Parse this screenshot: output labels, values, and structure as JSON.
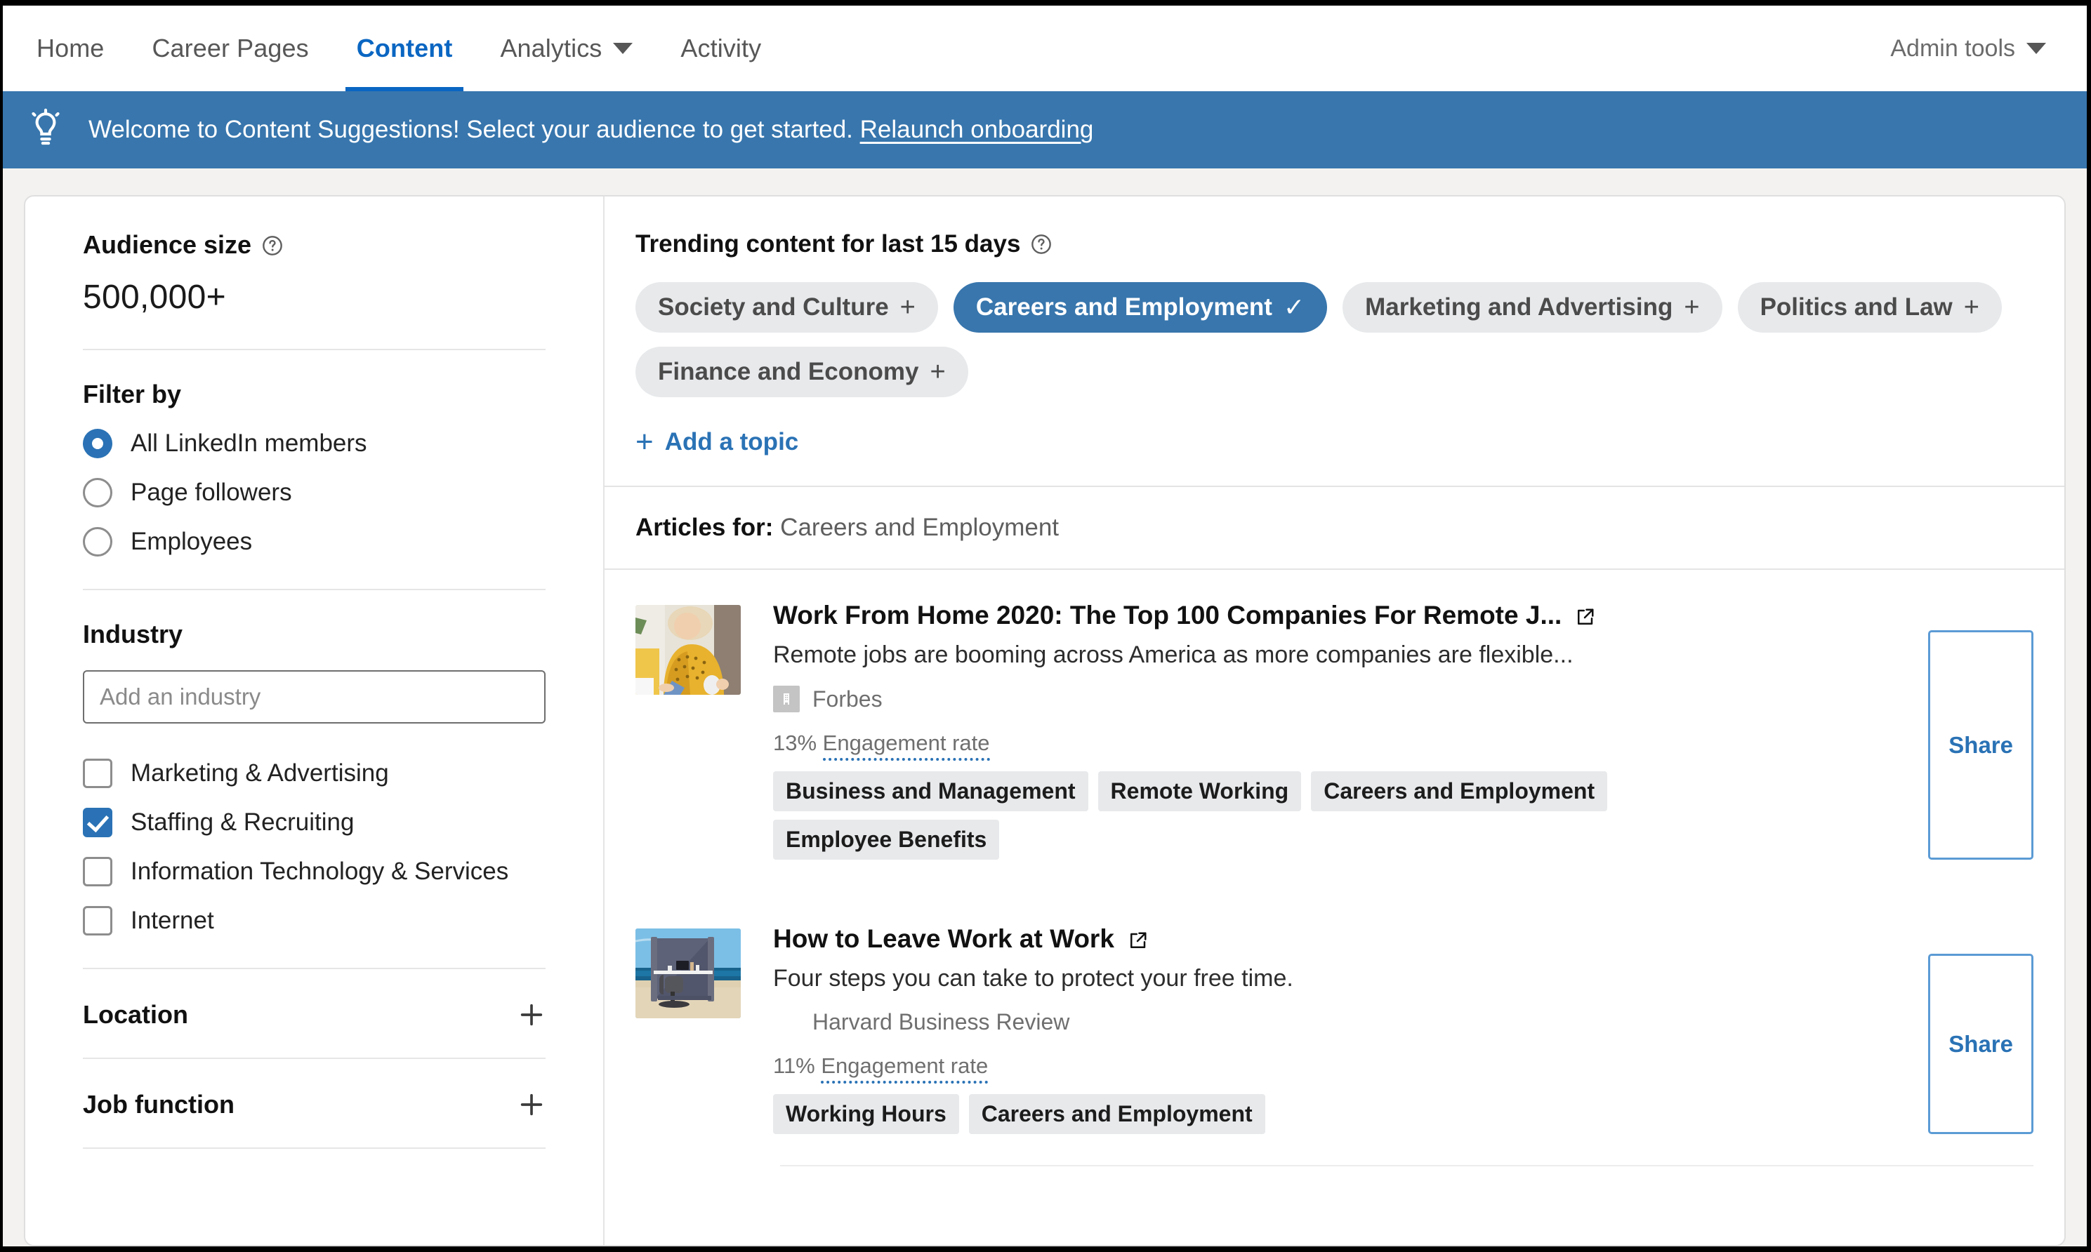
{
  "nav": {
    "items": [
      {
        "label": "Home",
        "active": false,
        "caret": false
      },
      {
        "label": "Career Pages",
        "active": false,
        "caret": false
      },
      {
        "label": "Content",
        "active": true,
        "caret": false
      },
      {
        "label": "Analytics",
        "active": false,
        "caret": true
      },
      {
        "label": "Activity",
        "active": false,
        "caret": false
      }
    ],
    "admin_tools": "Admin tools"
  },
  "banner": {
    "icon": "lightbulb-icon",
    "text": "Welcome to Content Suggestions! Select your audience to get started.",
    "link": "Relaunch onboarding",
    "background": "#3876ad"
  },
  "sidebar": {
    "audience_size_label": "Audience size",
    "audience_size_value": "500,000+",
    "filter_by_label": "Filter by",
    "audience_options": [
      {
        "label": "All LinkedIn members",
        "selected": true
      },
      {
        "label": "Page followers",
        "selected": false
      },
      {
        "label": "Employees",
        "selected": false
      }
    ],
    "industry_label": "Industry",
    "industry_placeholder": "Add an industry",
    "industry_value": "",
    "industries": [
      {
        "label": "Marketing & Advertising",
        "checked": false
      },
      {
        "label": "Staffing & Recruiting",
        "checked": true
      },
      {
        "label": "Information Technology & Services",
        "checked": false
      },
      {
        "label": "Internet",
        "checked": false
      }
    ],
    "collapsed_sections": [
      {
        "label": "Location",
        "glyph": "+"
      },
      {
        "label": "Job function",
        "glyph": "+"
      }
    ]
  },
  "main": {
    "trending_title": "Trending content for last 15 days",
    "topics": [
      {
        "label": "Society and Culture",
        "glyph": "+",
        "selected": false
      },
      {
        "label": "Careers and Employment",
        "glyph": "✓",
        "selected": true
      },
      {
        "label": "Marketing and Advertising",
        "glyph": "+",
        "selected": false
      },
      {
        "label": "Politics and Law",
        "glyph": "+",
        "selected": false
      },
      {
        "label": "Finance and Economy",
        "glyph": "+",
        "selected": false
      }
    ],
    "add_topic_label": "Add a topic",
    "articles_for_label": "Articles for:",
    "articles_for_value": "Careers and Employment",
    "share_label": "Share",
    "articles": [
      {
        "title": "Work From Home 2020: The Top 100 Companies For Remote J...",
        "description": "Remote jobs are booming across America as more companies are flexible...",
        "publisher": "Forbes",
        "has_publisher_logo": true,
        "engagement_rate": "13%",
        "engagement_label": "Engagement rate",
        "tags": [
          "Business and Management",
          "Remote Working",
          "Careers and Employment",
          "Employee Benefits"
        ],
        "thumbnail": "woman-yellow-sweater-laptop-photo"
      },
      {
        "title": "How to Leave Work at Work",
        "description": "Four steps you can take to protect your free time.",
        "publisher": "Harvard Business Review",
        "has_publisher_logo": false,
        "engagement_rate": "11%",
        "engagement_label": "Engagement rate",
        "tags": [
          "Working Hours",
          "Careers and Employment"
        ],
        "thumbnail": "beach-office-desk-photo"
      }
    ]
  },
  "colors": {
    "accent_blue": "#0a66c2",
    "banner_blue": "#3876ad",
    "chip_selected": "#3876ad",
    "chip_bg": "#e7e9eb",
    "link_blue": "#2a72b5"
  }
}
